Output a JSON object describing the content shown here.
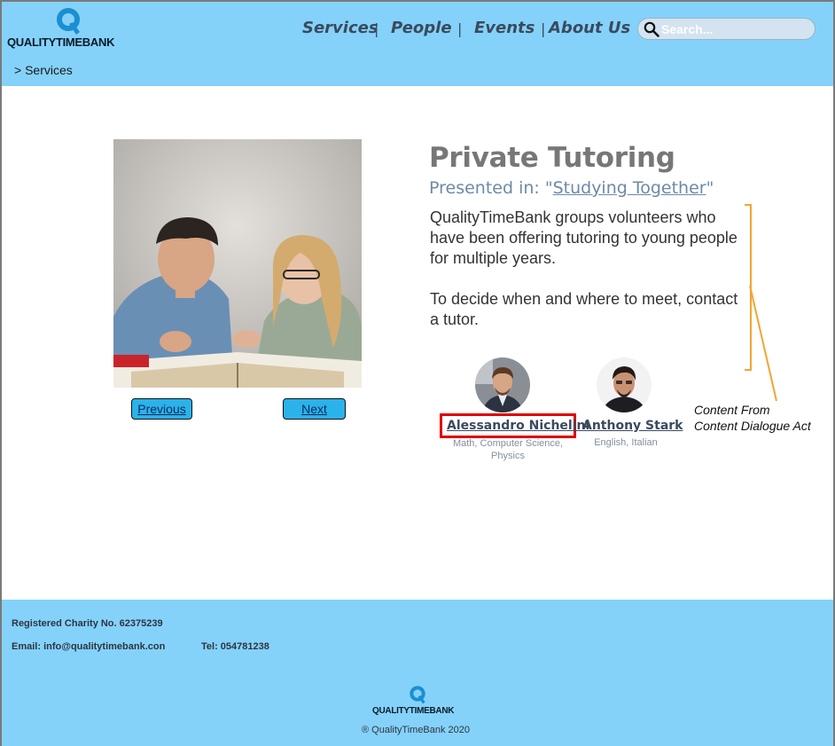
{
  "header": {
    "logo_text": "QUALITYTIMEBANK",
    "nav": [
      "Services",
      "People",
      "Events",
      "About Us"
    ],
    "search_placeholder": "Search...",
    "breadcrumb": "> Services"
  },
  "service": {
    "title": "Private Tutoring",
    "presented_prefix": "Presented in: \"",
    "presented_link": "Studying Together",
    "presented_suffix": "\"",
    "description_1": "QualityTimeBank groups volunteers who have been offering tutoring to young people for multiple years.",
    "description_2": "To decide when and where to meet, contact a tutor."
  },
  "gallery": {
    "previous_label": "Previous",
    "next_label": "Next"
  },
  "tutors": [
    {
      "name": "Alessandro Nichelini",
      "subjects": "Math, Computer Science, Physics"
    },
    {
      "name": "Anthony Stark",
      "subjects": "English, Italian"
    }
  ],
  "annotation": {
    "line1": "Content From",
    "line2": "Content Dialogue Act",
    "color": "#f5a431",
    "highlight_color": "#e00000"
  },
  "footer": {
    "charity": "Registered Charity No. 62375239",
    "email": "Email:  info@qualitytimebank.con",
    "tel": "Tel: 054781238",
    "logo_text": "QUALITYTIMEBANK",
    "copyright": "® QualityTimeBank 2020"
  },
  "colors": {
    "header_bg": "#84d2fa",
    "button_bg": "#2bb2ea",
    "nav_text": "#3b4a5e",
    "logo_q": "#1b8fd0"
  }
}
